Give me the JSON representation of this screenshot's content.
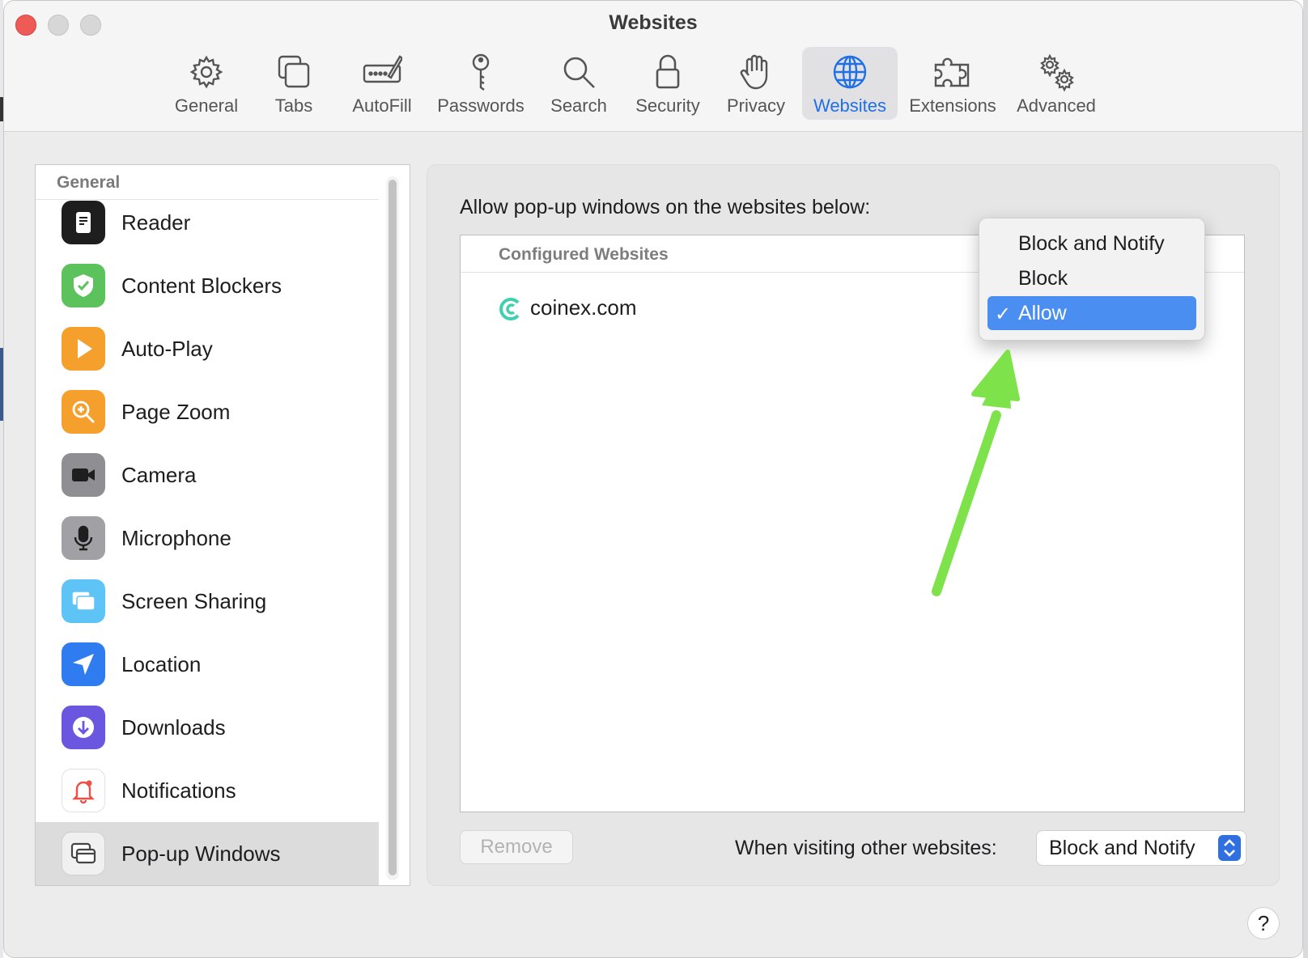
{
  "window": {
    "title": "Websites"
  },
  "toolbar": {
    "items": [
      {
        "label": "General",
        "icon": "gear-icon"
      },
      {
        "label": "Tabs",
        "icon": "tabs-icon"
      },
      {
        "label": "AutoFill",
        "icon": "pencil-form-icon"
      },
      {
        "label": "Passwords",
        "icon": "key-icon"
      },
      {
        "label": "Search",
        "icon": "search-icon"
      },
      {
        "label": "Security",
        "icon": "lock-icon"
      },
      {
        "label": "Privacy",
        "icon": "hand-icon"
      },
      {
        "label": "Websites",
        "icon": "globe-icon",
        "active": true
      },
      {
        "label": "Extensions",
        "icon": "puzzle-icon"
      },
      {
        "label": "Advanced",
        "icon": "gears-icon"
      }
    ]
  },
  "sidebar": {
    "header": "General",
    "items": [
      {
        "label": "Reader",
        "icon": "reader-icon"
      },
      {
        "label": "Content Blockers",
        "icon": "shield-icon"
      },
      {
        "label": "Auto-Play",
        "icon": "play-icon"
      },
      {
        "label": "Page Zoom",
        "icon": "zoom-icon"
      },
      {
        "label": "Camera",
        "icon": "camera-icon"
      },
      {
        "label": "Microphone",
        "icon": "microphone-icon"
      },
      {
        "label": "Screen Sharing",
        "icon": "screen-sharing-icon"
      },
      {
        "label": "Location",
        "icon": "location-icon"
      },
      {
        "label": "Downloads",
        "icon": "download-icon"
      },
      {
        "label": "Notifications",
        "icon": "bell-icon"
      },
      {
        "label": "Pop-up Windows",
        "icon": "popup-window-icon",
        "selected": true
      }
    ]
  },
  "panel": {
    "heading": "Allow pop-up windows on the websites below:",
    "table_header": "Configured Websites",
    "sites": [
      {
        "name": "coinex.com",
        "setting": "Allow"
      }
    ],
    "remove_label": "Remove",
    "other_label": "When visiting other websites:",
    "other_value": "Block and Notify"
  },
  "menu": {
    "options": [
      "Block and Notify",
      "Block",
      "Allow"
    ],
    "selected": "Allow",
    "checkmark": "✓"
  },
  "help_label": "?",
  "colors": {
    "accent": "#1f6fe5",
    "selection": "#4a8ef1",
    "annotation_arrow": "#7ee34a"
  }
}
